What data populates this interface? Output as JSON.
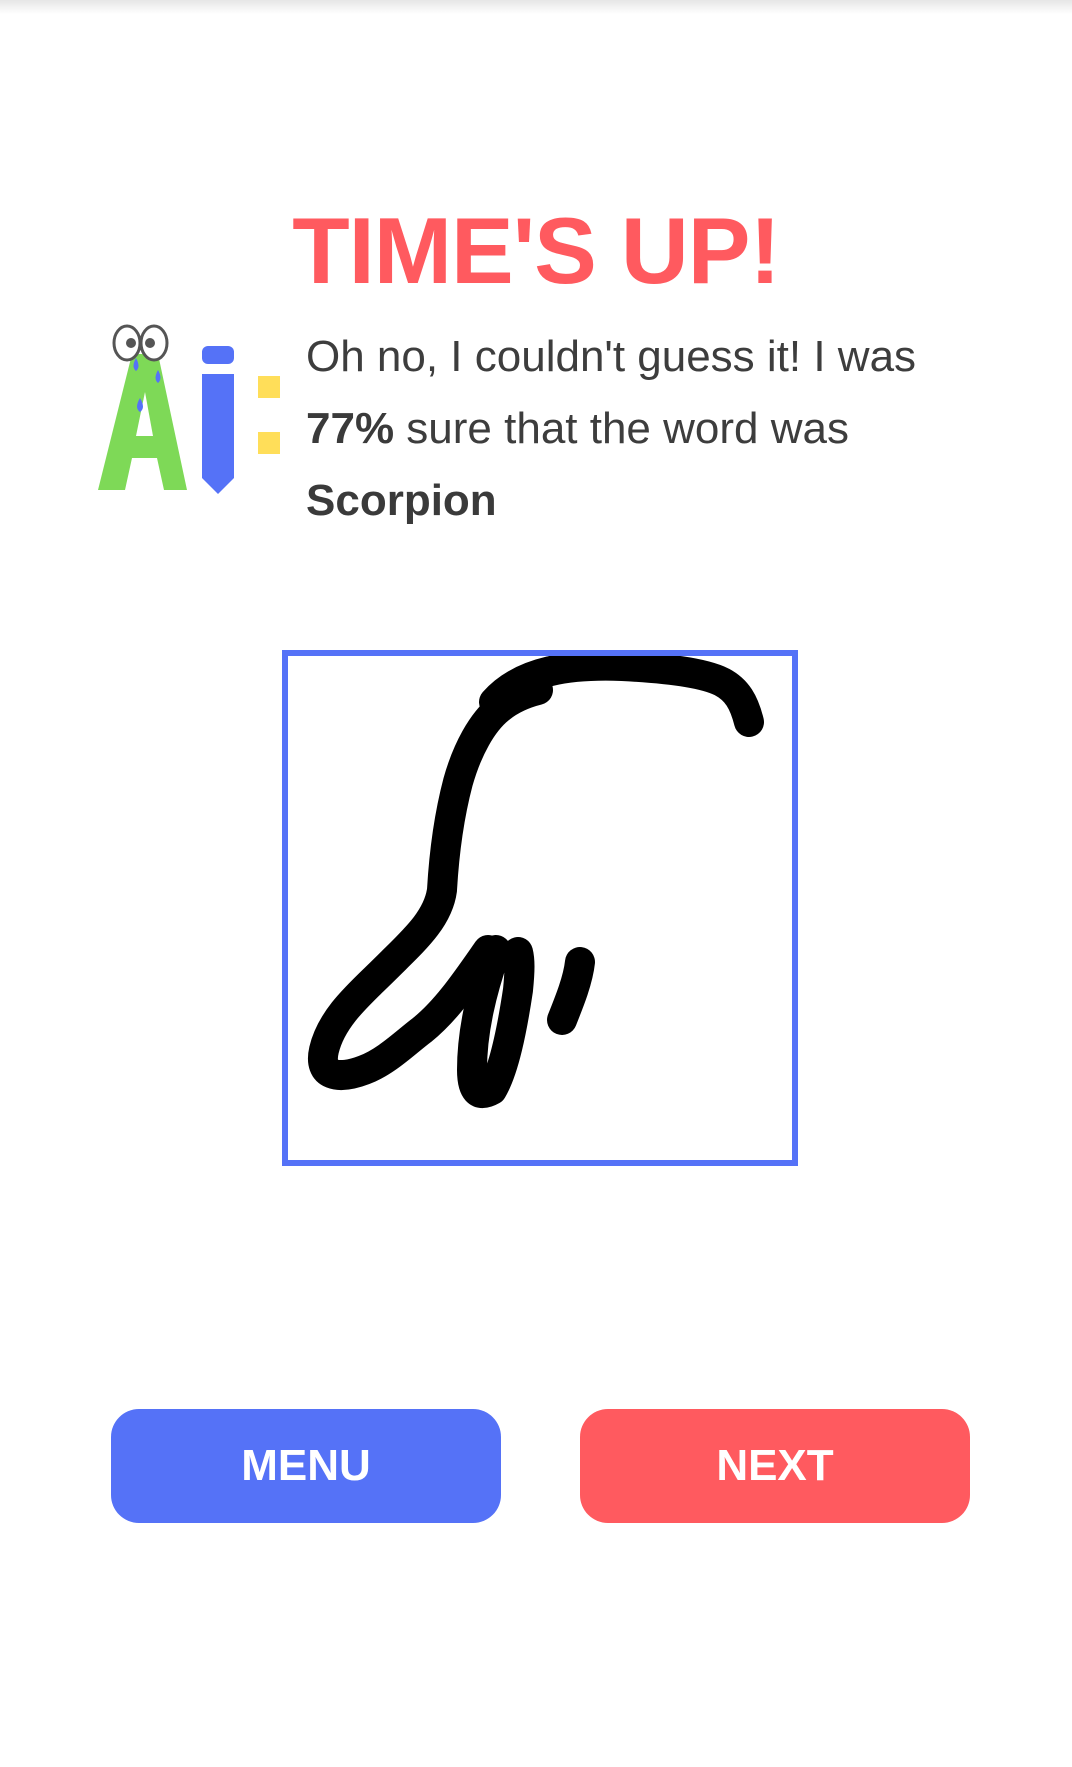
{
  "title": "TIME'S UP!",
  "message": {
    "line1": "Oh no, I couldn't guess it! I was",
    "percent": "77%",
    "line2_rest": " sure that the word was",
    "word": "Scorpion"
  },
  "logo": {
    "text": "Ai:",
    "icon": "crying-ai-pencil-logo"
  },
  "buttons": {
    "menu_label": "MENU",
    "next_label": "NEXT"
  },
  "colors": {
    "title_red": "#ff5a5f",
    "accent_blue": "#5572f7",
    "logo_green": "#7ed957",
    "logo_yellow": "#ffde59",
    "text": "#3d3d3d"
  }
}
